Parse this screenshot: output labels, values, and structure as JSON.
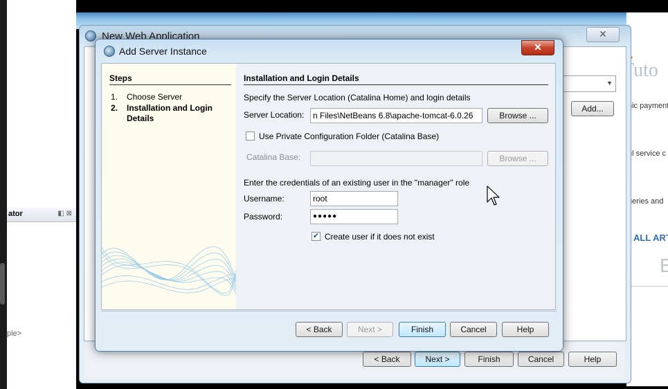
{
  "background": {
    "left_ide": {
      "navigator_label": "ator",
      "code_fragment": "ple>"
    },
    "web_page": {
      "title_fragment": "Tuto",
      "snippets": [
        "nic payment",
        "ul service c",
        "ueries and"
      ],
      "link_fragment": "ALL ART",
      "big_fragment": "E"
    }
  },
  "back_window": {
    "title": "New Web Application",
    "close_label": "✕",
    "add_button": "Add...",
    "buttons": {
      "back": "< Back",
      "next": "Next >",
      "finish": "Finish",
      "cancel": "Cancel",
      "help": "Help"
    }
  },
  "dialog": {
    "title": "Add Server Instance",
    "close_label": "✕",
    "steps": {
      "heading": "Steps",
      "items": [
        {
          "num": "1.",
          "label": "Choose Server"
        },
        {
          "num": "2.",
          "label": "Installation and Login Details"
        }
      ]
    },
    "content": {
      "heading": "Installation and Login Details",
      "intro": "Specify the Server Location (Catalina Home) and login details",
      "server_location_label": "Server Location:",
      "server_location_value": "n Files\\NetBeans 6.8\\apache-tomcat-6.0.26",
      "browse_label": "Browse ...",
      "private_config_label": "Use Private Configuration Folder (Catalina Base)",
      "catalina_base_label": "Catalina Base:",
      "catalina_base_value": "",
      "browse_disabled_label": "Browse ...",
      "credentials_intro": "Enter the credentials of an existing user in the \"manager\" role",
      "username_label": "Username:",
      "username_value": "root",
      "password_label": "Password:",
      "password_value": "●●●●●",
      "create_user_label": "Create user if it does not exist",
      "create_user_checked": true,
      "private_config_checked": false
    },
    "buttons": {
      "back": "< Back",
      "next": "Next >",
      "finish": "Finish",
      "cancel": "Cancel",
      "help": "Help"
    }
  }
}
